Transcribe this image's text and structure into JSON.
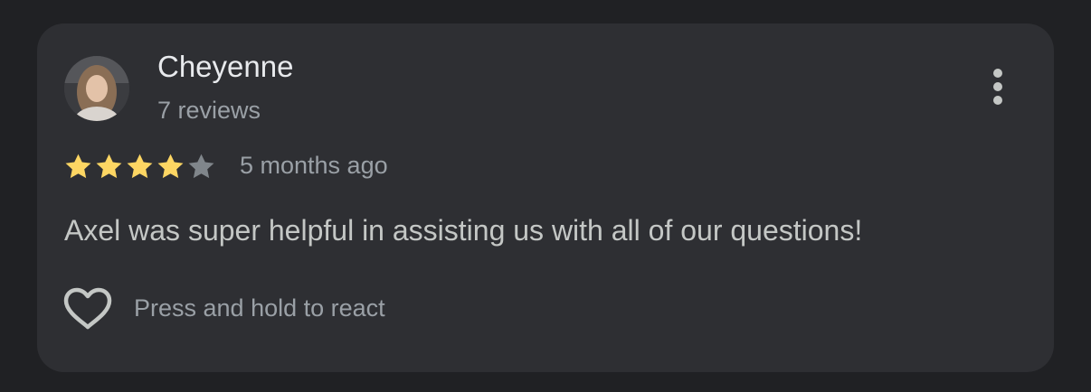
{
  "review": {
    "author_name": "Cheyenne",
    "review_count": "7 reviews",
    "rating": 4,
    "max_rating": 5,
    "time_ago": "5 months ago",
    "text": "Axel was super helpful in assisting us with all of our questions!",
    "react_hint": "Press and hold to react"
  },
  "icons": {
    "more": "more-vert-icon",
    "heart": "heart-outline-icon",
    "star": "star-icon"
  },
  "colors": {
    "background": "#202124",
    "card": "#2e2f33",
    "star_filled": "#fdd663",
    "star_empty": "#80868b",
    "primary_text": "#e8eaed",
    "secondary_text": "#9aa0a6"
  }
}
